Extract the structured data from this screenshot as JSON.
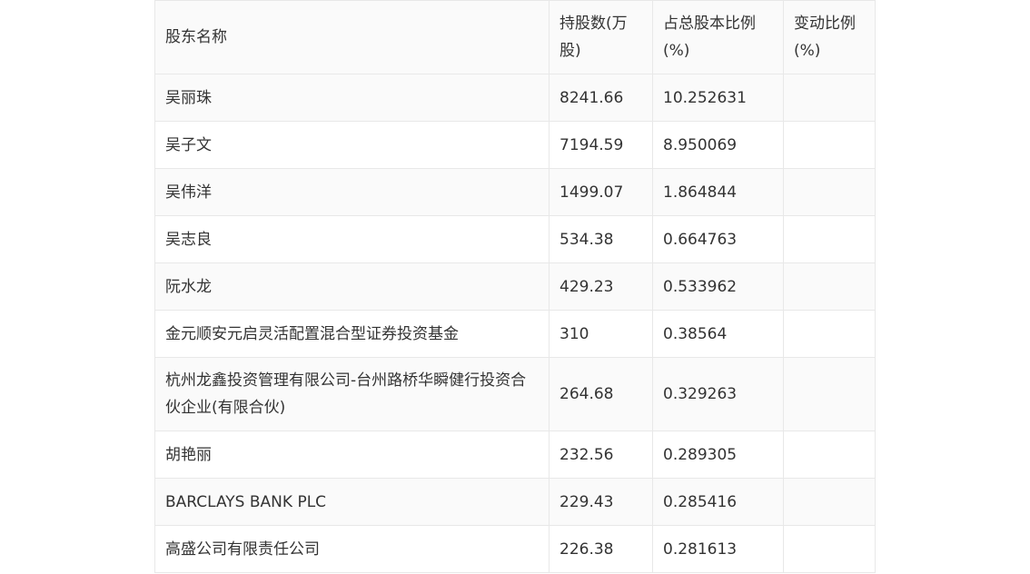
{
  "table": {
    "headers": [
      "股东名称",
      "持股数(万股)",
      "占总股本比例(%)",
      "变动比例(%)"
    ],
    "rows": [
      [
        "吴丽珠",
        "8241.66",
        "10.252631",
        ""
      ],
      [
        "吴子文",
        "7194.59",
        "8.950069",
        ""
      ],
      [
        "吴伟洋",
        "1499.07",
        "1.864844",
        ""
      ],
      [
        "吴志良",
        "534.38",
        "0.664763",
        ""
      ],
      [
        "阮水龙",
        "429.23",
        "0.533962",
        ""
      ],
      [
        "金元顺安元启灵活配置混合型证券投资基金",
        "310",
        "0.38564",
        ""
      ],
      [
        "杭州龙鑫投资管理有限公司-台州路桥华瞬健行投资合伙企业(有限合伙)",
        "264.68",
        "0.329263",
        ""
      ],
      [
        "胡艳丽",
        "232.56",
        "0.289305",
        ""
      ],
      [
        "BARCLAYS BANK PLC",
        "229.43",
        "0.285416",
        ""
      ],
      [
        "高盛公司有限责任公司",
        "226.38",
        "0.281613",
        ""
      ]
    ]
  }
}
